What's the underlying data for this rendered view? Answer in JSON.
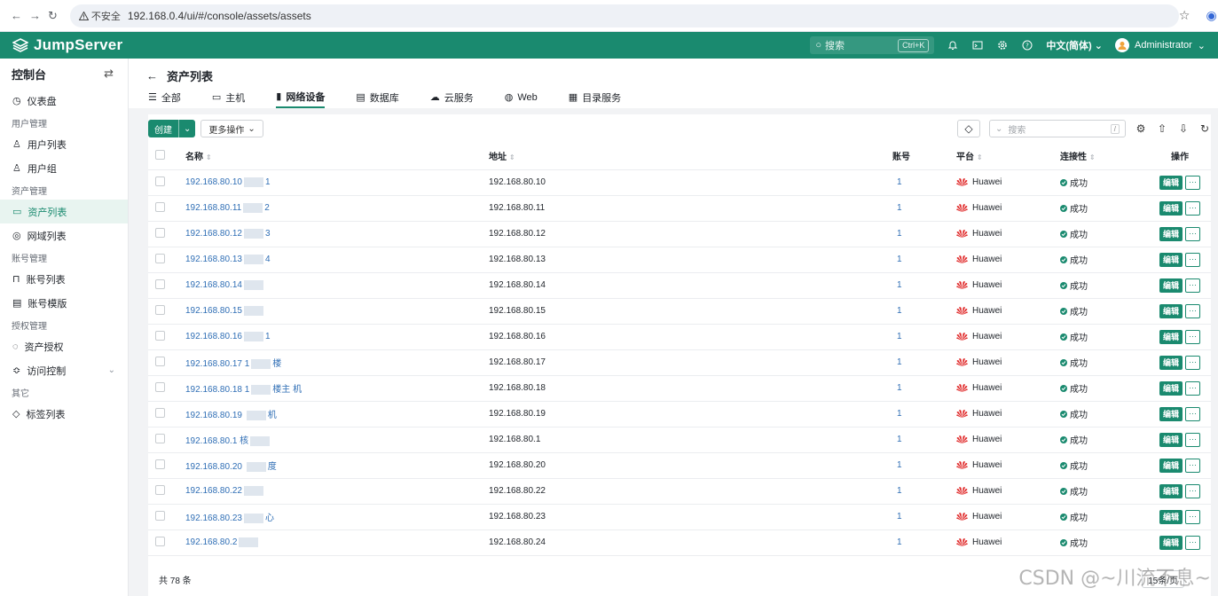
{
  "browser": {
    "security_label": "不安全",
    "url": "192.168.0.4/ui/#/console/assets/assets"
  },
  "header": {
    "brand": "JumpServer",
    "search_placeholder": "搜索",
    "search_shortcut": "Ctrl+K",
    "language": "中文(简体)",
    "user": "Administrator"
  },
  "sidebar": {
    "title": "控制台",
    "dashboard": "仪表盘",
    "groups": {
      "user_mgmt": "用户管理",
      "asset_mgmt": "资产管理",
      "account_mgmt": "账号管理",
      "auth_mgmt": "授权管理",
      "other": "其它"
    },
    "items": {
      "user_list": "用户列表",
      "user_group": "用户组",
      "asset_list": "资产列表",
      "domain_list": "网域列表",
      "account_list": "账号列表",
      "account_template": "账号模版",
      "asset_perm": "资产授权",
      "access_control": "访问控制",
      "label_list": "标签列表"
    }
  },
  "page": {
    "title": "资产列表",
    "tabs": [
      "全部",
      "主机",
      "网络设备",
      "数据库",
      "云服务",
      "Web",
      "目录服务"
    ],
    "active_tab": "网络设备"
  },
  "toolbar": {
    "create": "创建",
    "more_actions": "更多操作",
    "search_placeholder": "搜索",
    "search_hint": "/"
  },
  "table": {
    "headers": {
      "name": "名称",
      "address": "地址",
      "accounts": "账号",
      "platform": "平台",
      "connectivity": "连接性",
      "actions": "操作"
    },
    "edit_label": "编辑",
    "more_label": "···",
    "rows": [
      {
        "name": "192.168.80.10",
        "suffix": "1",
        "address": "192.168.80.10",
        "accounts": "1",
        "platform": "Huawei",
        "status": "成功"
      },
      {
        "name": "192.168.80.11",
        "suffix": "2",
        "address": "192.168.80.11",
        "accounts": "1",
        "platform": "Huawei",
        "status": "成功"
      },
      {
        "name": "192.168.80.12",
        "suffix": "3",
        "address": "192.168.80.12",
        "accounts": "1",
        "platform": "Huawei",
        "status": "成功"
      },
      {
        "name": "192.168.80.13",
        "suffix": "4",
        "address": "192.168.80.13",
        "accounts": "1",
        "platform": "Huawei",
        "status": "成功"
      },
      {
        "name": "192.168.80.14",
        "suffix": "",
        "address": "192.168.80.14",
        "accounts": "1",
        "platform": "Huawei",
        "status": "成功"
      },
      {
        "name": "192.168.80.15",
        "suffix": "",
        "address": "192.168.80.15",
        "accounts": "1",
        "platform": "Huawei",
        "status": "成功"
      },
      {
        "name": "192.168.80.16",
        "suffix": "1",
        "address": "192.168.80.16",
        "accounts": "1",
        "platform": "Huawei",
        "status": "成功"
      },
      {
        "name": "192.168.80.17 1",
        "suffix": "楼",
        "address": "192.168.80.17",
        "accounts": "1",
        "platform": "Huawei",
        "status": "成功"
      },
      {
        "name": "192.168.80.18 1",
        "suffix": "楼主 机",
        "address": "192.168.80.18",
        "accounts": "1",
        "platform": "Huawei",
        "status": "成功"
      },
      {
        "name": "192.168.80.19 ",
        "suffix": "机",
        "address": "192.168.80.19",
        "accounts": "1",
        "platform": "Huawei",
        "status": "成功"
      },
      {
        "name": "192.168.80.1 核",
        "suffix": "",
        "address": "192.168.80.1",
        "accounts": "1",
        "platform": "Huawei",
        "status": "成功"
      },
      {
        "name": "192.168.80.20 ",
        "suffix": "度",
        "address": "192.168.80.20",
        "accounts": "1",
        "platform": "Huawei",
        "status": "成功"
      },
      {
        "name": "192.168.80.22",
        "suffix": "",
        "address": "192.168.80.22",
        "accounts": "1",
        "platform": "Huawei",
        "status": "成功"
      },
      {
        "name": "192.168.80.23",
        "suffix": "心",
        "address": "192.168.80.23",
        "accounts": "1",
        "platform": "Huawei",
        "status": "成功"
      },
      {
        "name": "192.168.80.2",
        "suffix": "",
        "address": "192.168.80.24",
        "accounts": "1",
        "platform": "Huawei",
        "status": "成功"
      }
    ]
  },
  "footer": {
    "total": "共 78 条",
    "page_size": "15条/页"
  },
  "watermark": "CSDN @~川流不息~",
  "colors": {
    "brand": "#1a8a6f",
    "link": "#2f6eb5",
    "huawei": "#e02a2a"
  }
}
